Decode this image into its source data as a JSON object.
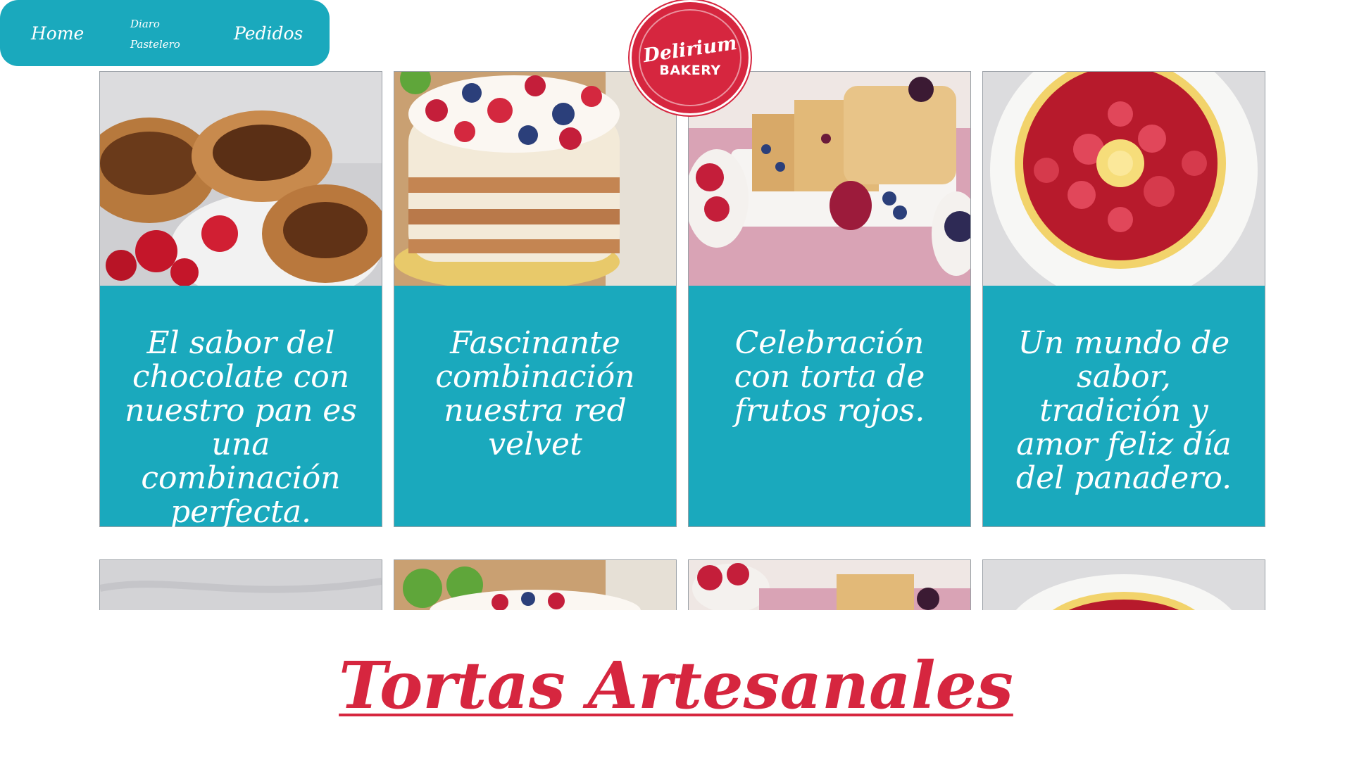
{
  "nav": {
    "home": "Home",
    "diario": "Diaro Pastelero",
    "pedidos": "Pedidos"
  },
  "logo": {
    "script": "Delirium",
    "sub": "BAKERY",
    "color": "#d6263f"
  },
  "theme": {
    "accent": "#1aa9bd",
    "heading_color": "#d6263f"
  },
  "cards": [
    {
      "caption": "El sabor del chocolate con nuestro pan es una combinación perfecta.",
      "image": "chocolate-bread-photo"
    },
    {
      "caption": "Fascinante combinación nuestra red velvet",
      "image": "berry-naked-cake-photo"
    },
    {
      "caption": "Celebración con torta de frutos rojos.",
      "image": "berry-loaf-cake-photo"
    },
    {
      "caption": "Un mundo de sabor, tradición y amor feliz día del panadero.",
      "image": "strawberry-tart-photo"
    }
  ],
  "section": {
    "heading": "Tortas Artesanales"
  }
}
